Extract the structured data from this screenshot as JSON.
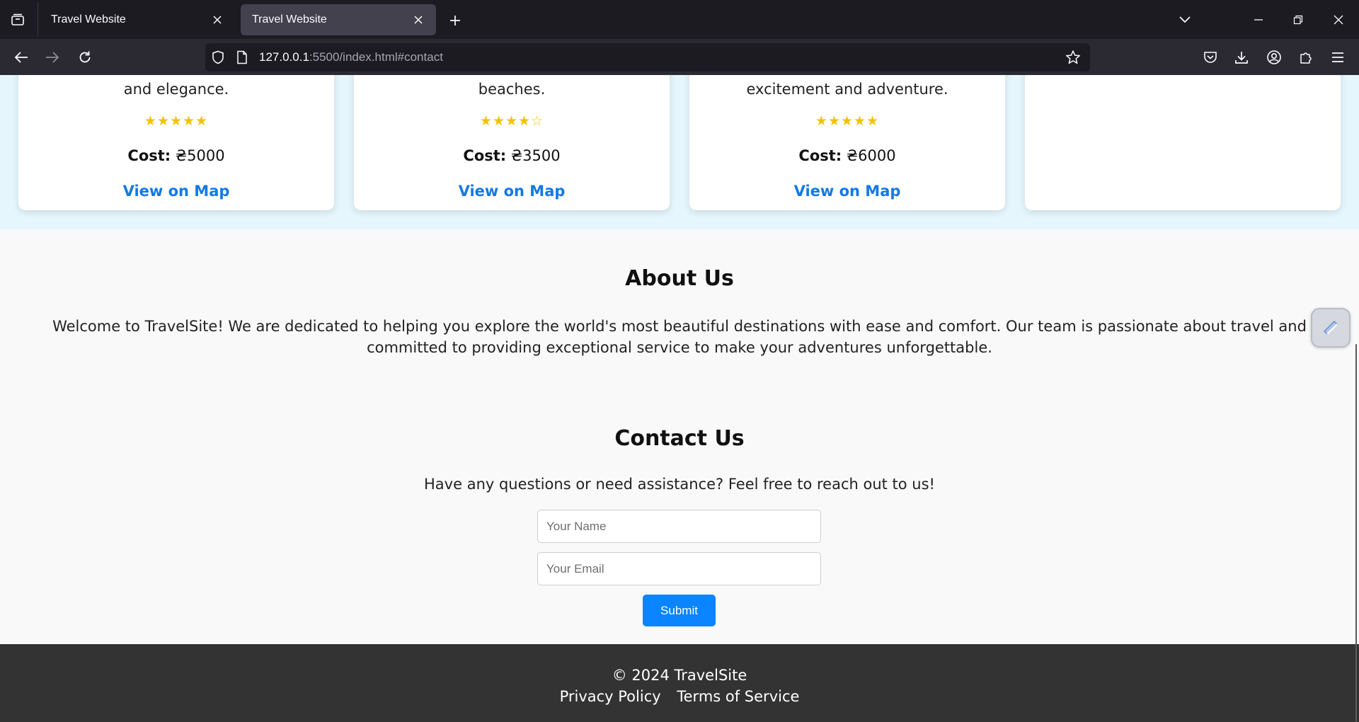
{
  "browser": {
    "tabs": [
      {
        "title": "Travel Website",
        "active": false
      },
      {
        "title": "Travel Website",
        "active": true
      }
    ],
    "url_host": "127.0.0.1",
    "url_rest": ":5500/index.html#contact",
    "icons": {
      "tab_list": "tab-list-icon",
      "close": "close-icon",
      "new_tab": "plus-icon",
      "list_all_tabs": "chevron-down-icon",
      "minimize": "minimize-icon",
      "restore": "restore-icon",
      "window_close": "close-icon",
      "back": "back-arrow-icon",
      "forward": "forward-arrow-icon",
      "reload": "reload-icon",
      "shield": "shield-icon",
      "page": "page-icon",
      "bookmark": "star-icon",
      "pocket": "pocket-icon",
      "downloads": "download-icon",
      "account": "account-icon",
      "extensions": "puzzle-icon",
      "menu": "hamburger-icon"
    }
  },
  "destinations": {
    "cards": [
      {
        "desc": "and elegance.",
        "rating": "★★★★★",
        "cost_label": "Cost:",
        "cost_value": " ₴5000",
        "map_link": "View on Map"
      },
      {
        "desc": "beaches.",
        "rating": "★★★★☆",
        "cost_label": "Cost:",
        "cost_value": " ₴3500",
        "map_link": "View on Map"
      },
      {
        "desc": "excitement and adventure.",
        "rating": "★★★★★",
        "cost_label": "Cost:",
        "cost_value": " ₴6000",
        "map_link": "View on Map"
      },
      {
        "desc": "",
        "rating": "",
        "cost_label": "",
        "cost_value": "",
        "map_link": ""
      }
    ],
    "rating_color": "#f2c200",
    "link_color": "#1279e6"
  },
  "about": {
    "title": "About Us",
    "text": "Welcome to TravelSite! We are dedicated to helping you explore the world's most beautiful destinations with ease and comfort. Our team is passionate about travel and committed to providing exceptional service to make your adventures unforgettable."
  },
  "contact": {
    "title": "Contact Us",
    "text": "Have any questions or need assistance? Feel free to reach out to us!",
    "name_placeholder": "Your Name",
    "email_placeholder": "Your Email",
    "submit_label": "Submit",
    "accent": "#0a84ff"
  },
  "footer": {
    "copyright": "© 2024 TravelSite",
    "links": [
      "Privacy Policy",
      "Terms of Service"
    ],
    "background": "#333333"
  }
}
